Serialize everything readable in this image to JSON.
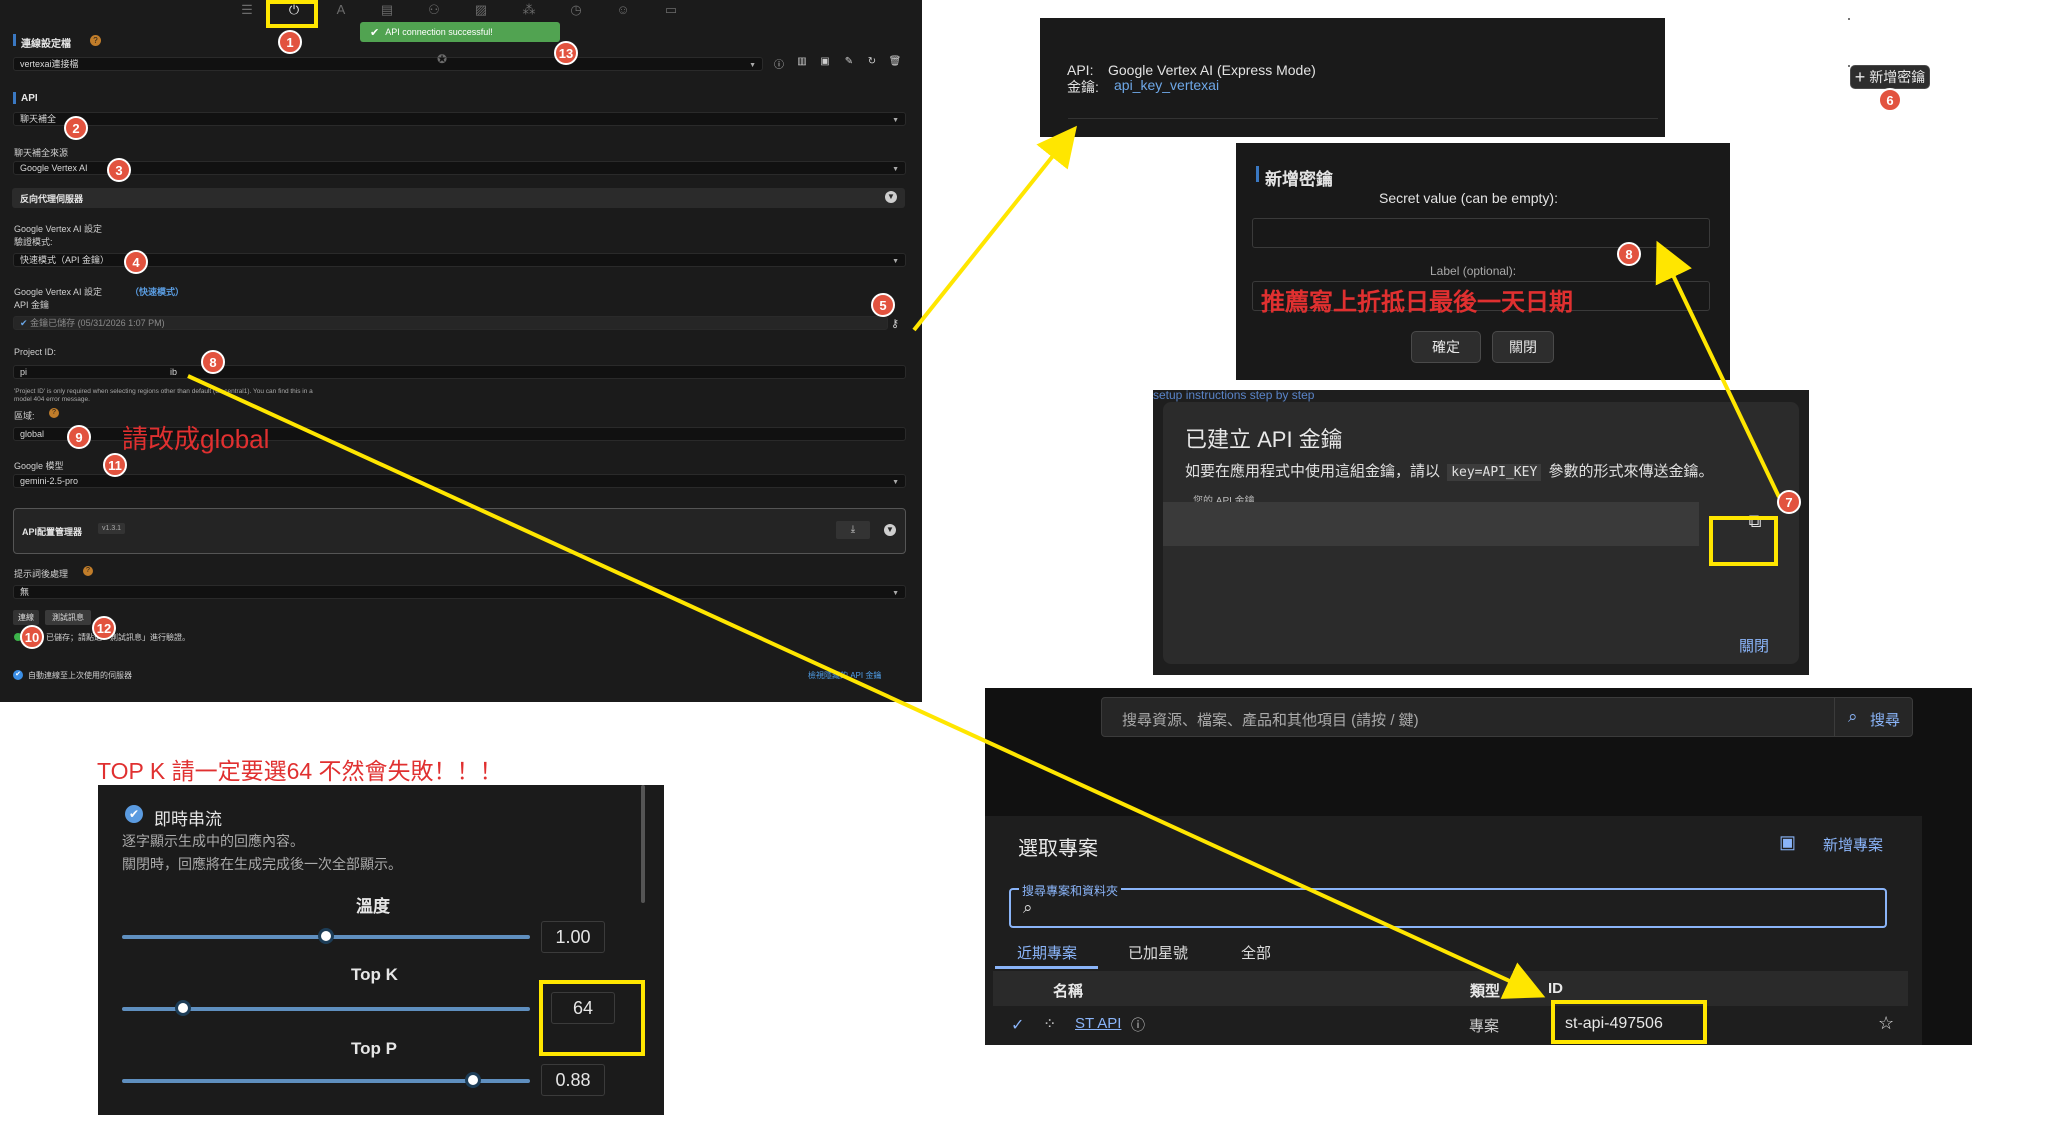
{
  "st_panel": {
    "toast": "API connection successful!",
    "section_connection": "連線設定檔",
    "profile_value": "vertexai連接檔",
    "section_api": "API",
    "api_type_value": "聊天補全",
    "chat_source_label": "聊天補全來源",
    "chat_source_value": "Google Vertex AI",
    "reverse_proxy_label": "反向代理伺服器",
    "vertex_settings_title": "Google Vertex AI 設定",
    "auth_mode_label": "驗證模式:",
    "auth_mode_value": "快速模式（API 金鑰）",
    "vertex_settings_title2": "Google Vertex AI 設定",
    "express_mode_tag": "（快速模式）",
    "api_key_label": "API 金鑰",
    "key_saved_text": "金鑰已儲存 (05/31/2026 1:07 PM)",
    "project_id_label": "Project ID:",
    "project_id_value": "pi",
    "project_id_tail": "ib",
    "project_note": "'Project ID' is only required when selecting regions other than default (us-central1). You can find this in a model 404 error message.",
    "region_label": "區域:",
    "region_value": "global",
    "model_label": "Google 模型",
    "model_value": "gemini-2.5-pro",
    "api_manager_title": "API配置管理器",
    "api_manager_version": "v1.3.1",
    "post_processing_label": "提示詞後處理",
    "post_processing_value": "無",
    "connect_button": "連線",
    "test_message_button": "測試訊息",
    "status_text": "已儲存；請點選「測試訊息」進行驗證。",
    "auto_connect_label": "自動連線至上次使用的伺服器",
    "view_hidden_keys_link": "檢視隱藏的 API 金鑰"
  },
  "annotations": {
    "region_note": "請改成global",
    "topk_note": "TOP K 請一定要選64 不然會失敗！！！",
    "label_note": "推薦寫上折抵日最後一天日期"
  },
  "secrets_header": {
    "api_label": "API:",
    "api_value": "Google Vertex AI (Express Mode)",
    "key_label": "金鑰:",
    "key_value": "api_key_vertexai",
    "add_secret_button": "新增密鑰"
  },
  "add_secret_dialog": {
    "title": "新增密鑰",
    "secret_value_label": "Secret value (can be empty):",
    "label_optional": "Label (optional):",
    "confirm_button": "確定",
    "close_button": "關閉"
  },
  "api_key_created": {
    "bg_text": "setup instructions step by step",
    "title": "已建立 API 金鑰",
    "desc_before": "如要在應用程式中使用這組金鑰，請以",
    "code": "key=API_KEY",
    "desc_after": "參數的形式來傳送金鑰。",
    "field_label": "您的 API 金鑰",
    "close_link": "關閉"
  },
  "gcp": {
    "search_placeholder": "搜尋資源、檔案、產品和其他項目 (請按 / 鍵)",
    "search_button": "搜尋",
    "dialog_title": "選取專案",
    "new_project_button": "新增專案",
    "search_projects_label": "搜尋專案和資料夾",
    "tabs": [
      "近期專案",
      "已加星號",
      "全部"
    ],
    "columns": [
      "名稱",
      "類型",
      "ID"
    ],
    "row": {
      "name": "ST API",
      "type": "專案",
      "id": "st-api-497506"
    }
  },
  "sampler": {
    "streaming_label": "即時串流",
    "streaming_desc1": "逐字顯示生成中的回應內容。",
    "streaming_desc2": "關閉時，回應將在生成完成後一次全部顯示。",
    "temperature_label": "溫度",
    "temperature_value": "1.00",
    "temperature_fraction": 0.5,
    "topk_label": "Top K",
    "topk_value": "64",
    "topk_fraction": 0.15,
    "topp_label": "Top P",
    "topp_value": "0.88",
    "topp_fraction": 0.86
  },
  "markers": [
    "1",
    "2",
    "3",
    "4",
    "5",
    "8",
    "9",
    "11",
    "10",
    "12",
    "13",
    "6",
    "8",
    "7"
  ],
  "colors": {
    "accent": "#ffe600",
    "marker": "#e2533f",
    "note_red": "#e03030",
    "link_blue": "#8ab4f8"
  }
}
